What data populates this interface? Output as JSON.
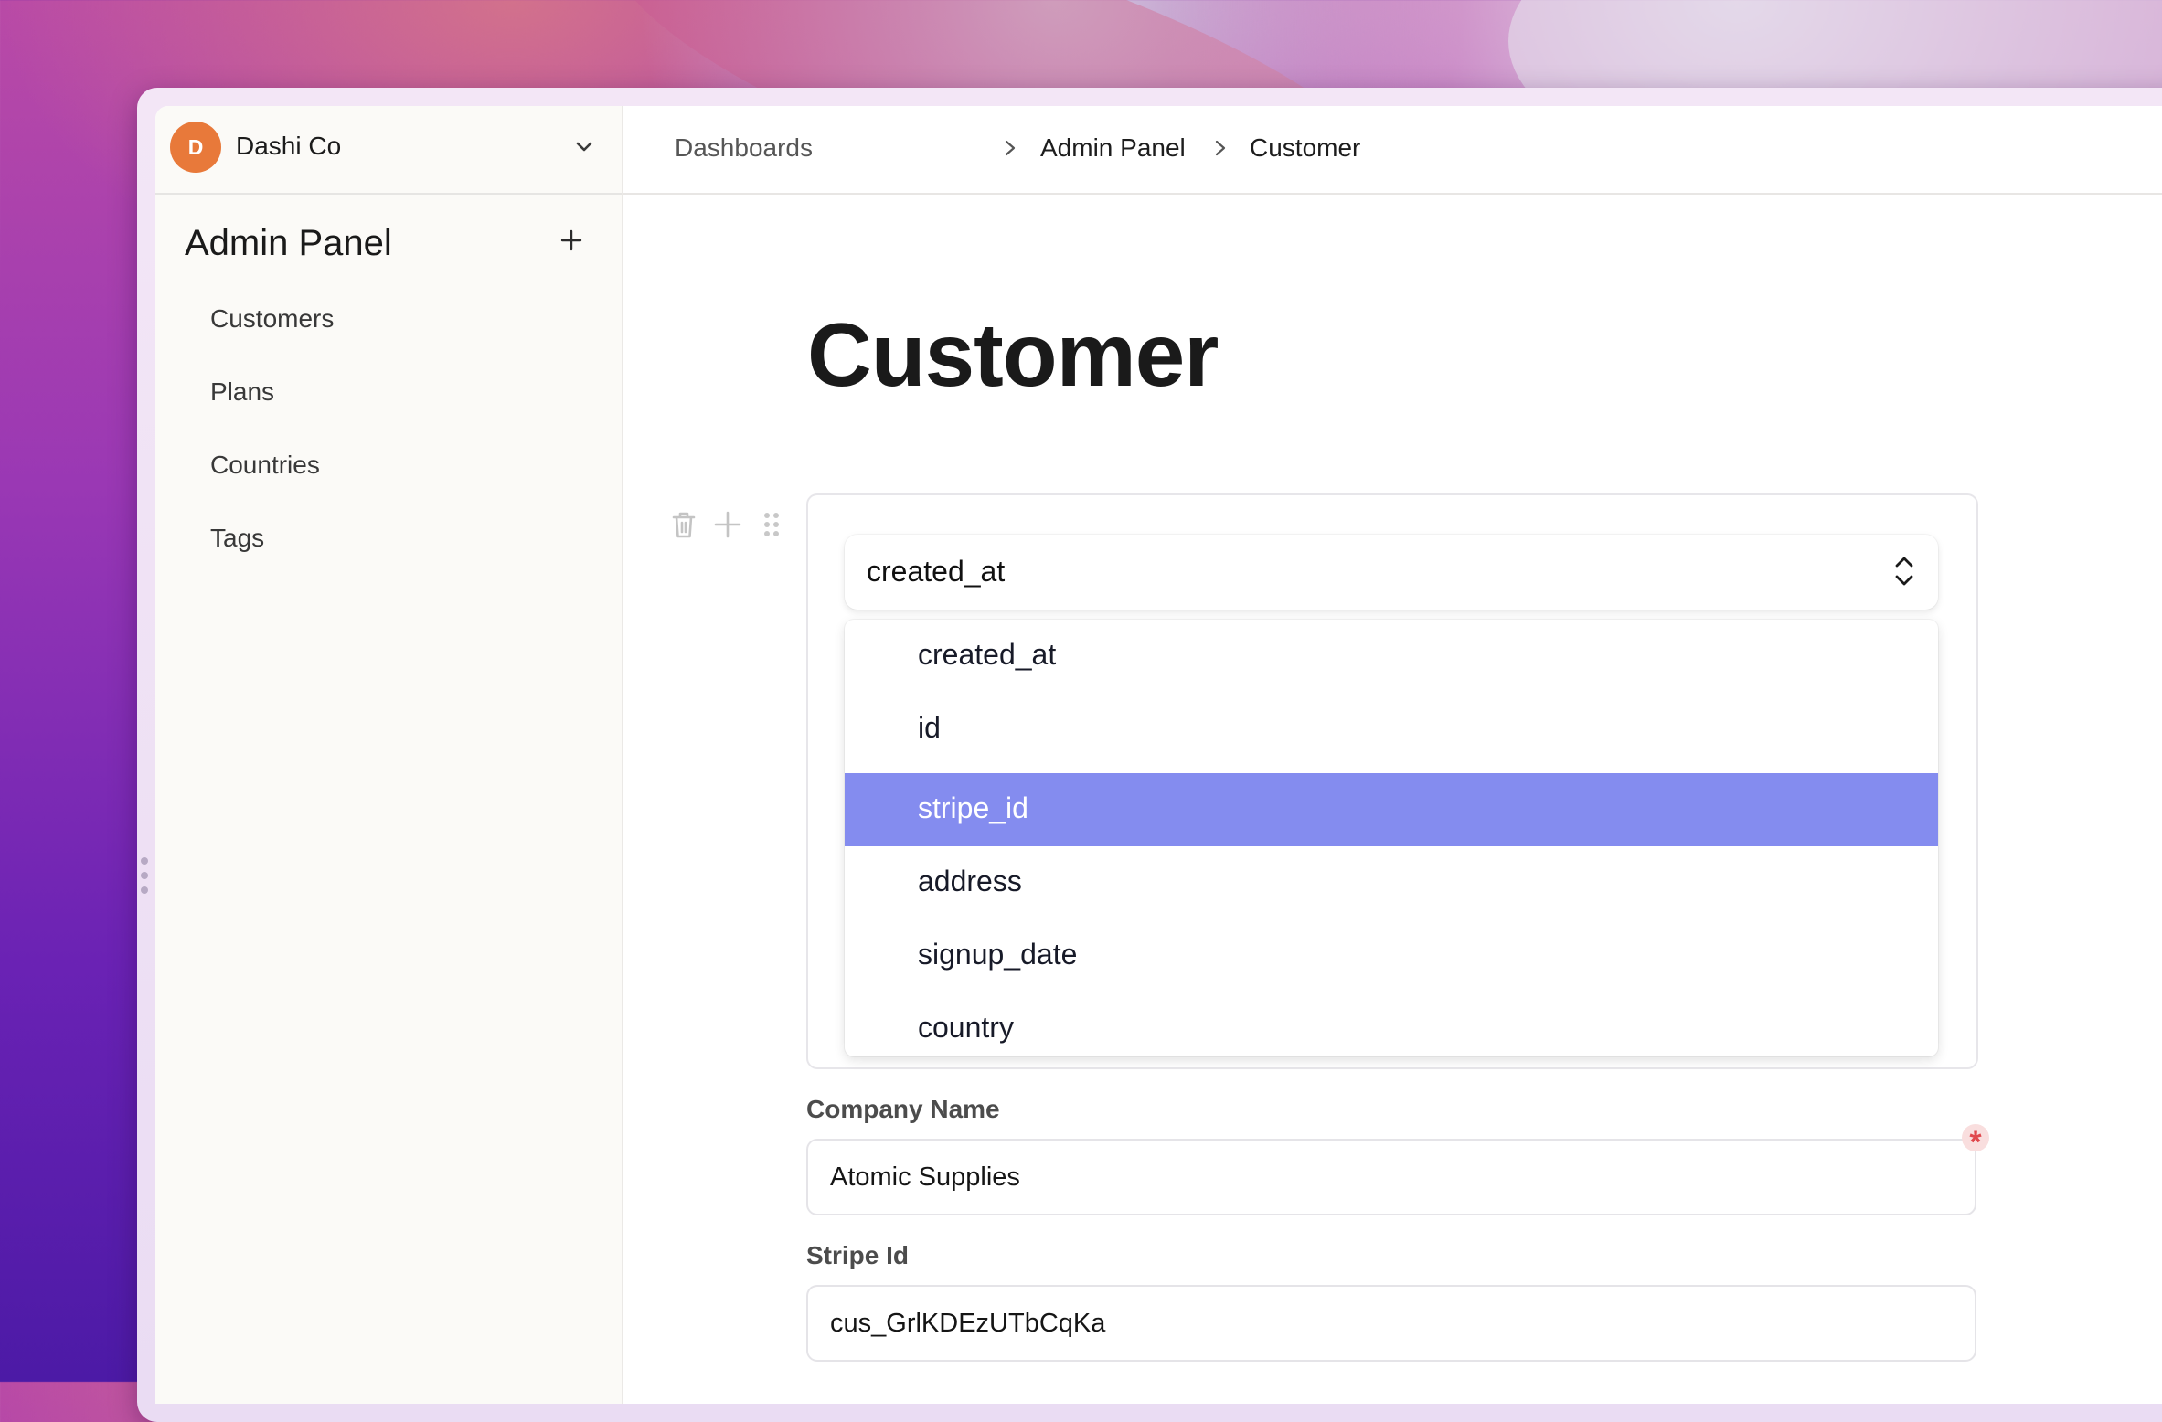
{
  "org": {
    "avatar_initial": "D",
    "name": "Dashi Co",
    "avatar_color": "#e8793a"
  },
  "sidebar": {
    "title": "Admin Panel",
    "items": [
      {
        "label": "Customers"
      },
      {
        "label": "Plans"
      },
      {
        "label": "Countries"
      },
      {
        "label": "Tags"
      }
    ]
  },
  "breadcrumb": [
    {
      "label": "Dashboards"
    },
    {
      "label": "Admin Panel"
    },
    {
      "label": "Customer"
    }
  ],
  "page": {
    "title": "Customer"
  },
  "block": {
    "icons": [
      "trash-icon",
      "plus-icon",
      "drag-handle-icon"
    ],
    "select": {
      "value": "created_at",
      "options": [
        {
          "label": "created_at"
        },
        {
          "label": "id"
        },
        {
          "label": "stripe_id",
          "highlighted": true
        },
        {
          "label": "address"
        },
        {
          "label": "signup_date"
        },
        {
          "label": "country"
        }
      ]
    },
    "highlight_color": "#848cef"
  },
  "form": {
    "fields": [
      {
        "label": "Company Name",
        "value": "Atomic Supplies",
        "required": true
      },
      {
        "label": "Stripe Id",
        "value": "cus_GrlKDEzUTbCqKa",
        "required": false
      }
    ],
    "required_marker": "*",
    "required_color": "#e0474c"
  }
}
